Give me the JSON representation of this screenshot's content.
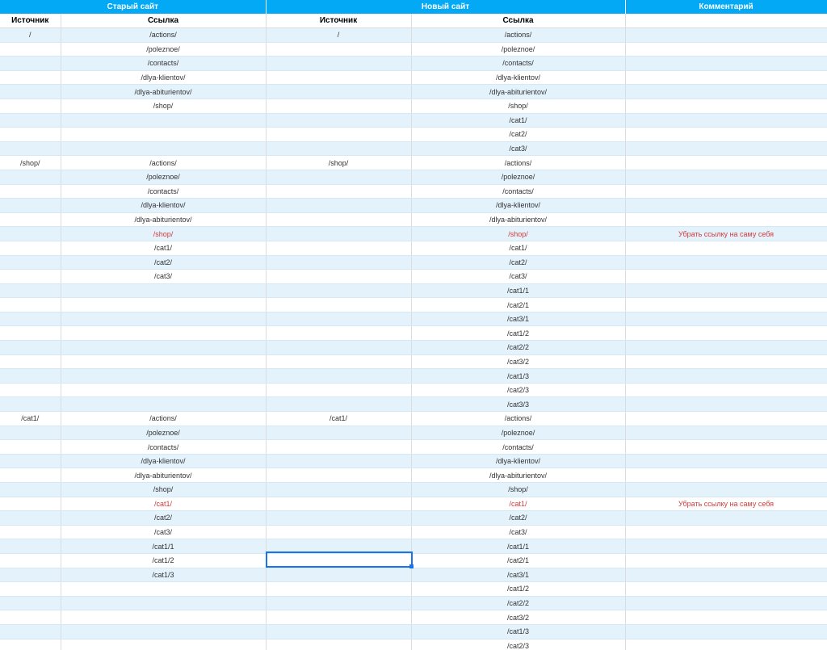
{
  "groups": [
    {
      "label": "Старый сайт",
      "span": 2
    },
    {
      "label": "Новый сайт",
      "span": 2
    },
    {
      "label": "Комментарий",
      "span": 1
    }
  ],
  "columns": [
    "Источник",
    "Ссылка",
    "Источник",
    "Ссылка",
    ""
  ],
  "accent_color": "#03a9f4",
  "highlight_color": "#d23b3b",
  "rows": [
    {
      "cells": [
        "/",
        "/actions/",
        "/",
        "/actions/",
        ""
      ]
    },
    {
      "cells": [
        "",
        "/poleznoe/",
        "",
        "/poleznoe/",
        ""
      ]
    },
    {
      "cells": [
        "",
        "/contacts/",
        "",
        "/contacts/",
        ""
      ]
    },
    {
      "cells": [
        "",
        "/dlya-klientov/",
        "",
        "/dlya-klientov/",
        ""
      ]
    },
    {
      "cells": [
        "",
        "/dlya-abiturientov/",
        "",
        "/dlya-abiturientov/",
        ""
      ]
    },
    {
      "cells": [
        "",
        "/shop/",
        "",
        "/shop/",
        ""
      ]
    },
    {
      "cells": [
        "",
        "",
        "",
        "/cat1/",
        ""
      ]
    },
    {
      "cells": [
        "",
        "",
        "",
        "/cat2/",
        ""
      ]
    },
    {
      "cells": [
        "",
        "",
        "",
        "/cat3/",
        ""
      ]
    },
    {
      "cells": [
        "/shop/",
        "/actions/",
        "/shop/",
        "/actions/",
        ""
      ]
    },
    {
      "cells": [
        "",
        "/poleznoe/",
        "",
        "/poleznoe/",
        ""
      ]
    },
    {
      "cells": [
        "",
        "/contacts/",
        "",
        "/contacts/",
        ""
      ]
    },
    {
      "cells": [
        "",
        "/dlya-klientov/",
        "",
        "/dlya-klientov/",
        ""
      ]
    },
    {
      "cells": [
        "",
        "/dlya-abiturientov/",
        "",
        "/dlya-abiturientov/",
        ""
      ]
    },
    {
      "cells": [
        "",
        "/shop/",
        "",
        "/shop/",
        "Убрать ссылку на саму себя"
      ],
      "highlight": true
    },
    {
      "cells": [
        "",
        "/cat1/",
        "",
        "/cat1/",
        ""
      ]
    },
    {
      "cells": [
        "",
        "/cat2/",
        "",
        "/cat2/",
        ""
      ]
    },
    {
      "cells": [
        "",
        "/cat3/",
        "",
        "/cat3/",
        ""
      ]
    },
    {
      "cells": [
        "",
        "",
        "",
        "/cat1/1",
        ""
      ]
    },
    {
      "cells": [
        "",
        "",
        "",
        "/cat2/1",
        ""
      ]
    },
    {
      "cells": [
        "",
        "",
        "",
        "/cat3/1",
        ""
      ]
    },
    {
      "cells": [
        "",
        "",
        "",
        "/cat1/2",
        ""
      ]
    },
    {
      "cells": [
        "",
        "",
        "",
        "/cat2/2",
        ""
      ]
    },
    {
      "cells": [
        "",
        "",
        "",
        "/cat3/2",
        ""
      ]
    },
    {
      "cells": [
        "",
        "",
        "",
        "/cat1/3",
        ""
      ]
    },
    {
      "cells": [
        "",
        "",
        "",
        "/cat2/3",
        ""
      ]
    },
    {
      "cells": [
        "",
        "",
        "",
        "/cat3/3",
        ""
      ]
    },
    {
      "cells": [
        "/cat1/",
        "/actions/",
        "/cat1/",
        "/actions/",
        ""
      ]
    },
    {
      "cells": [
        "",
        "/poleznoe/",
        "",
        "/poleznoe/",
        ""
      ]
    },
    {
      "cells": [
        "",
        "/contacts/",
        "",
        "/contacts/",
        ""
      ]
    },
    {
      "cells": [
        "",
        "/dlya-klientov/",
        "",
        "/dlya-klientov/",
        ""
      ]
    },
    {
      "cells": [
        "",
        "/dlya-abiturientov/",
        "",
        "/dlya-abiturientov/",
        ""
      ]
    },
    {
      "cells": [
        "",
        "/shop/",
        "",
        "/shop/",
        ""
      ]
    },
    {
      "cells": [
        "",
        "/cat1/",
        "",
        "/cat1/",
        "Убрать ссылку на саму себя"
      ],
      "highlight": true
    },
    {
      "cells": [
        "",
        "/cat2/",
        "",
        "/cat2/",
        ""
      ]
    },
    {
      "cells": [
        "",
        "/cat3/",
        "",
        "/cat3/",
        ""
      ]
    },
    {
      "cells": [
        "",
        "/cat1/1",
        "",
        "/cat1/1",
        ""
      ]
    },
    {
      "cells": [
        "",
        "/cat1/2",
        "",
        "/cat2/1",
        ""
      ]
    },
    {
      "cells": [
        "",
        "/cat1/3",
        "",
        "/cat3/1",
        ""
      ]
    },
    {
      "cells": [
        "",
        "",
        "",
        "/cat1/2",
        ""
      ]
    },
    {
      "cells": [
        "",
        "",
        "",
        "/cat2/2",
        ""
      ]
    },
    {
      "cells": [
        "",
        "",
        "",
        "/cat3/2",
        ""
      ]
    },
    {
      "cells": [
        "",
        "",
        "",
        "/cat1/3",
        ""
      ]
    },
    {
      "cells": [
        "",
        "",
        "",
        "/cat2/3",
        ""
      ]
    }
  ]
}
